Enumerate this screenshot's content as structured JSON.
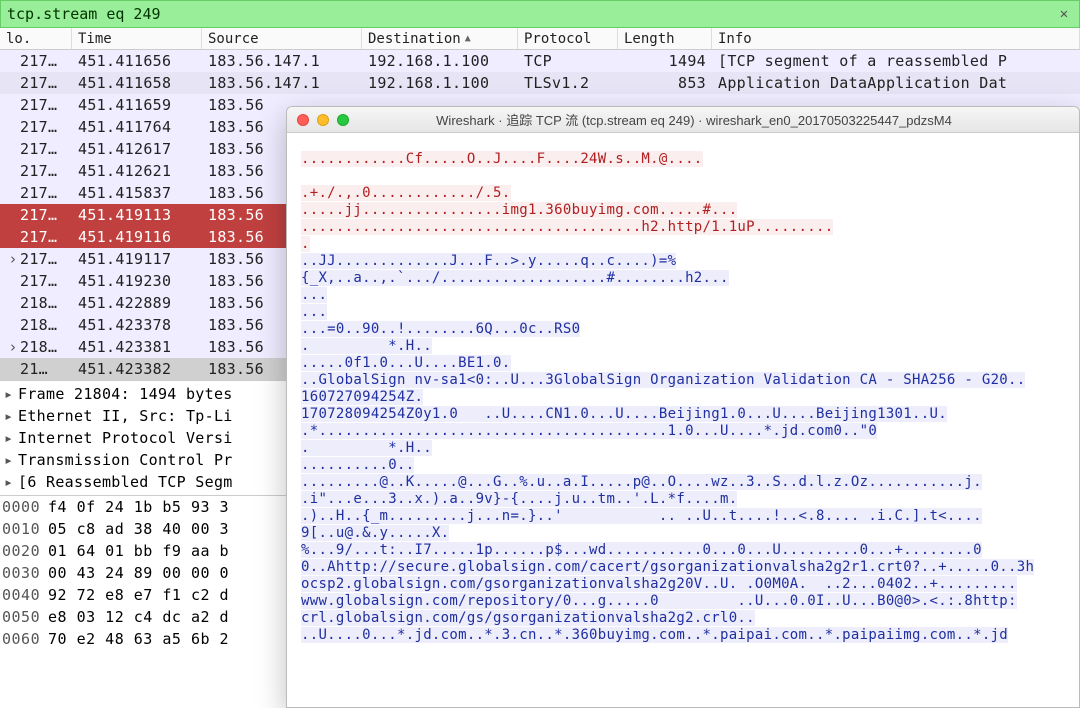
{
  "filter": {
    "value": "tcp.stream eq 249",
    "clear_tip": "Clear"
  },
  "columns": {
    "no": "lo.",
    "time": "Time",
    "source": "Source",
    "destination": "Destination",
    "protocol": "Protocol",
    "length": "Length",
    "info": "Info",
    "sort_indicator": "▲"
  },
  "column_widths": {
    "no": 72,
    "time": 130,
    "source": 160,
    "destination": 156,
    "protocol": 100,
    "length": 94,
    "info": 368
  },
  "packets": [
    {
      "style": "row-tcp",
      "gutter": "",
      "no": "217…",
      "time": "451.411656",
      "src": "183.56.147.1",
      "dst": "192.168.1.100",
      "proto": "TCP",
      "len": "1494",
      "info": "[TCP segment of a reassembled P"
    },
    {
      "style": "row-tls",
      "gutter": "",
      "no": "217…",
      "time": "451.411658",
      "src": "183.56.147.1",
      "dst": "192.168.1.100",
      "proto": "TLSv1.2",
      "len": "853",
      "info": "Application DataApplication Dat"
    },
    {
      "style": "row-tcp",
      "gutter": "",
      "no": "217…",
      "time": "451.411659",
      "src": "183.56",
      "dst": "",
      "proto": "",
      "len": "",
      "info": ""
    },
    {
      "style": "row-tcp",
      "gutter": "",
      "no": "217…",
      "time": "451.411764",
      "src": "183.56",
      "dst": "",
      "proto": "",
      "len": "",
      "info": ""
    },
    {
      "style": "row-tcp",
      "gutter": "",
      "no": "217…",
      "time": "451.412617",
      "src": "183.56",
      "dst": "",
      "proto": "",
      "len": "",
      "info": ""
    },
    {
      "style": "row-tcp",
      "gutter": "",
      "no": "217…",
      "time": "451.412621",
      "src": "183.56",
      "dst": "",
      "proto": "",
      "len": "",
      "info": ""
    },
    {
      "style": "row-tcp",
      "gutter": "",
      "no": "217…",
      "time": "451.415837",
      "src": "183.56",
      "dst": "",
      "proto": "",
      "len": "",
      "info": ""
    },
    {
      "style": "row-sel",
      "gutter": "",
      "no": "217…",
      "time": "451.419113",
      "src": "183.56",
      "dst": "",
      "proto": "",
      "len": "",
      "info": ""
    },
    {
      "style": "row-sel",
      "gutter": "",
      "no": "217…",
      "time": "451.419116",
      "src": "183.56",
      "dst": "",
      "proto": "",
      "len": "",
      "info": ""
    },
    {
      "style": "row-tcp",
      "gutter": "›",
      "no": "217…",
      "time": "451.419117",
      "src": "183.56",
      "dst": "",
      "proto": "",
      "len": "",
      "info": ""
    },
    {
      "style": "row-tcp",
      "gutter": "",
      "no": "217…",
      "time": "451.419230",
      "src": "183.56",
      "dst": "",
      "proto": "",
      "len": "",
      "info": ""
    },
    {
      "style": "row-tcp",
      "gutter": "",
      "no": "218…",
      "time": "451.422889",
      "src": "183.56",
      "dst": "",
      "proto": "",
      "len": "",
      "info": ""
    },
    {
      "style": "row-tcp",
      "gutter": "",
      "no": "218…",
      "time": "451.423378",
      "src": "183.56",
      "dst": "",
      "proto": "",
      "len": "",
      "info": ""
    },
    {
      "style": "row-tcp",
      "gutter": "›",
      "no": "218…",
      "time": "451.423381",
      "src": "183.56",
      "dst": "",
      "proto": "",
      "len": "",
      "info": ""
    },
    {
      "style": "row-last",
      "gutter": "",
      "no": "21…",
      "time": "451.423382",
      "src": "183.56",
      "dst": "",
      "proto": "",
      "len": "",
      "info": ""
    }
  ],
  "details": [
    "Frame 21804: 1494 bytes",
    "Ethernet II, Src: Tp-Li",
    "Internet Protocol Versi",
    "Transmission Control Pr",
    "[6 Reassembled TCP Segm"
  ],
  "hex": [
    {
      "off": "0000",
      "bytes": "f4 0f 24 1b b5 93 3"
    },
    {
      "off": "0010",
      "bytes": "05 c8 ad 38 40 00 3"
    },
    {
      "off": "0020",
      "bytes": "01 64 01 bb f9 aa b"
    },
    {
      "off": "0030",
      "bytes": "00 43 24 89 00 00 0"
    },
    {
      "off": "0040",
      "bytes": "92 72 e8 e7 f1 c2 d"
    },
    {
      "off": "0050",
      "bytes": "e8 03 12 c4 dc a2 d"
    },
    {
      "off": "0060",
      "bytes": "70 e2 48 63 a5 6b 2"
    }
  ],
  "follow": {
    "title": "Wireshark · 追踪 TCP 流 (tcp.stream eq 249) · wireshark_en0_20170503225447_pdzsM4",
    "lines": [
      {
        "c": "cli",
        "t": "............Cf.....O..J....F....24W.s..M.@...."
      },
      {
        "c": "",
        "t": ""
      },
      {
        "c": "cli",
        "t": ".+./.,.0............/.5."
      },
      {
        "c": "cli",
        "t": ".....jj................img1.360buyimg.com.....#..."
      },
      {
        "c": "cli",
        "t": ".......................................h2.http/1.1uP........."
      },
      {
        "c": "cli",
        "t": "."
      },
      {
        "c": "srv",
        "t": "..JJ.............J...F..>.y.....q..c....)=%"
      },
      {
        "c": "srv",
        "t": "{_X,..a..,.`.../...................#........h2..."
      },
      {
        "c": "srv",
        "t": "..."
      },
      {
        "c": "srv",
        "t": "..."
      },
      {
        "c": "srv",
        "t": "...=0..90..!........6Q...0c..RS0"
      },
      {
        "c": "srv",
        "t": ".         *.H.."
      },
      {
        "c": "srv",
        "t": ".....0f1.0...U....BE1.0."
      },
      {
        "c": "srv",
        "t": "..GlobalSign nv-sa1<0:..U...3GlobalSign Organization Validation CA - SHA256 - G20.."
      },
      {
        "c": "srv",
        "t": "160727094254Z."
      },
      {
        "c": "srv",
        "t": "170728094254Z0y1.0   ..U....CN1.0...U....Beijing1.0...U....Beijing1301..U."
      },
      {
        "c": "srv",
        "t": ".*........................................1.0...U....*.jd.com0..\"0"
      },
      {
        "c": "srv",
        "t": ".         *.H.."
      },
      {
        "c": "srv",
        "t": "..........0.."
      },
      {
        "c": "srv",
        "t": ".........@..K.....@...G..%.u..a.I.....p@..O....wz..3..S..d.l.z.Oz...........j."
      },
      {
        "c": "srv",
        "t": ".i\"...e...3..x.).a..9v}-{....j.u..tm..'.L.*f....m."
      },
      {
        "c": "srv",
        "t": ".)..H..{_m.........j...n=.}..'           .. ..U..t....!..<.8.... .i.C.].t<...."
      },
      {
        "c": "srv",
        "t": "9[..u@.&.y.....X."
      },
      {
        "c": "srv",
        "t": "%...9/...t:..I7.....1p......p$...wd...........0...0...U.........0...+........0"
      },
      {
        "c": "srv",
        "t": "0..Ahttp://secure.globalsign.com/cacert/gsorganizationvalsha2g2r1.crt0?..+.....0..3h"
      },
      {
        "c": "srv",
        "t": "ocsp2.globalsign.com/gsorganizationvalsha2g20V..U. .O0M0A.  ..2...0402..+........."
      },
      {
        "c": "srv",
        "t": "www.globalsign.com/repository/0...g.....0         ..U...0.0I..U...B0@0>.<.:.8http:"
      },
      {
        "c": "srv",
        "t": "crl.globalsign.com/gs/gsorganizationvalsha2g2.crl0.."
      },
      {
        "c": "srv",
        "t": "..U....0...*.jd.com..*.3.cn..*.360buyimg.com..*.paipai.com..*.paipaiimg.com..*.jd"
      }
    ]
  }
}
